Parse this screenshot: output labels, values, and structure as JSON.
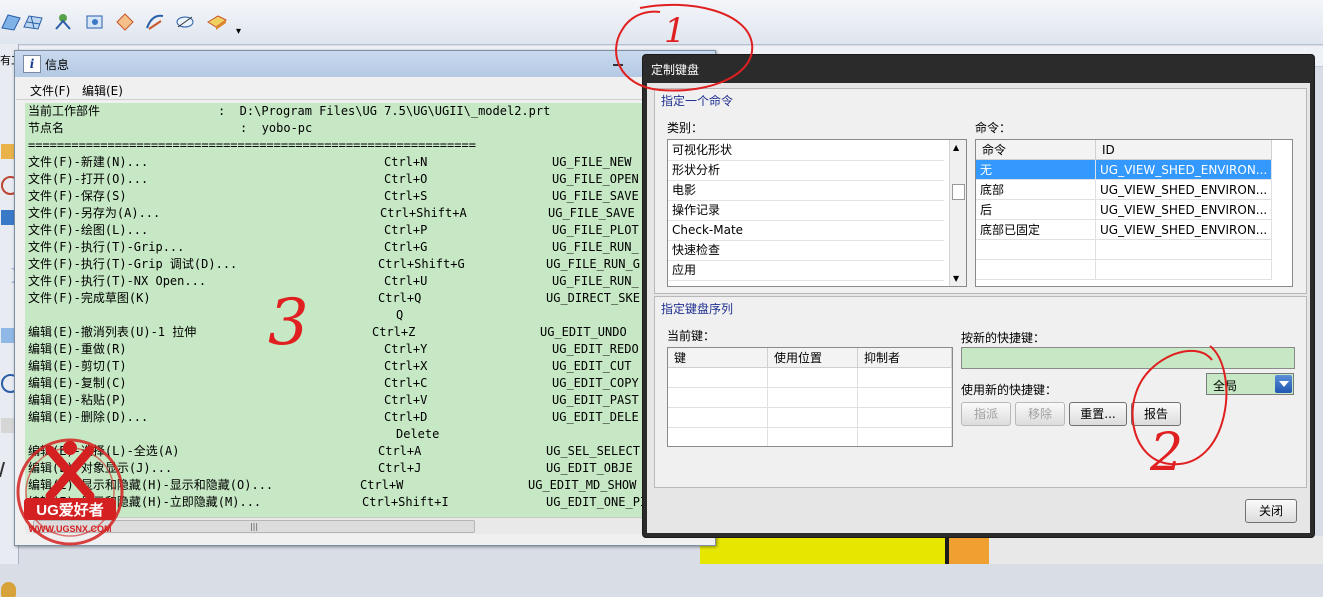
{
  "info_window": {
    "title": "信息",
    "menu": [
      "文件(F)",
      "编辑(E)"
    ],
    "header_lines": [
      {
        "label": "当前工作部件",
        "value": ":  D:\\Program Files\\UG 7.5\\UG\\UGII\\_model2.prt"
      },
      {
        "label": "节点名",
        "value": ":  yobo-pc"
      }
    ],
    "separator": "==============================================================",
    "rows": [
      {
        "cmd": "文件(F)-新建(N)...",
        "key": "Ctrl+N",
        "id": "UG_FILE_NEW"
      },
      {
        "cmd": "文件(F)-打开(O)...",
        "key": "Ctrl+O",
        "id": "UG_FILE_OPEN"
      },
      {
        "cmd": "文件(F)-保存(S)",
        "key": "Ctrl+S",
        "id": "UG_FILE_SAVE"
      },
      {
        "cmd": "文件(F)-另存为(A)...",
        "key": "Ctrl+Shift+A",
        "id": "UG_FILE_SAVE"
      },
      {
        "cmd": "文件(F)-绘图(L)...",
        "key": "Ctrl+P",
        "id": "UG_FILE_PLOT"
      },
      {
        "cmd": "文件(F)-执行(T)-Grip...",
        "key": "Ctrl+G",
        "id": "UG_FILE_RUN_"
      },
      {
        "cmd": "文件(F)-执行(T)-Grip 调试(D)...",
        "key": "Ctrl+Shift+G",
        "id": "UG_FILE_RUN_G"
      },
      {
        "cmd": "文件(F)-执行(T)-NX Open...",
        "key": "Ctrl+U",
        "id": "UG_FILE_RUN_"
      },
      {
        "cmd": "文件(F)-完成草图(K)",
        "key": "Ctrl+Q",
        "id": "UG_DIRECT_SKE"
      },
      {
        "cmd": "",
        "key": "Q",
        "id": ""
      },
      {
        "cmd": "编辑(E)-撤消列表(U)-1 拉伸",
        "key": "Ctrl+Z",
        "id": "UG_EDIT_UNDO"
      },
      {
        "cmd": "编辑(E)-重做(R)",
        "key": "Ctrl+Y",
        "id": "UG_EDIT_REDO"
      },
      {
        "cmd": "编辑(E)-剪切(T)",
        "key": "Ctrl+X",
        "id": "UG_EDIT_CUT"
      },
      {
        "cmd": "编辑(E)-复制(C)",
        "key": "Ctrl+C",
        "id": "UG_EDIT_COPY"
      },
      {
        "cmd": "编辑(E)-粘贴(P)",
        "key": "Ctrl+V",
        "id": "UG_EDIT_PAST"
      },
      {
        "cmd": "编辑(E)-删除(D)...",
        "key": "Ctrl+D",
        "id": "UG_EDIT_DELE"
      },
      {
        "cmd": "",
        "key": "Delete",
        "id": ""
      },
      {
        "cmd": "编辑(E)-选择(L)-全选(A)",
        "key": "Ctrl+A",
        "id": "UG_SEL_SELECT"
      },
      {
        "cmd": "编辑(E)-对象显示(J)...",
        "key": "Ctrl+J",
        "id": "UG_EDIT_OBJE"
      },
      {
        "cmd": "编辑(E)-显示和隐藏(H)-显示和隐藏(O)...",
        "key": "Ctrl+W",
        "id": "UG_EDIT_MD_SHOW"
      },
      {
        "cmd": "编辑(E)-显示和隐藏(H)-立即隐藏(M)...",
        "key": "Ctrl+Shift+I",
        "id": "UG_EDIT_ONE_PI"
      }
    ]
  },
  "keyboard_dialog": {
    "title": "定制键盘",
    "specify_command": {
      "group_title": "指定一个命令",
      "category_label": "类别：",
      "categories": [
        "可视化形状",
        "形状分析",
        "电影",
        "操作记录",
        "Check-Mate",
        "快速检查",
        "应用"
      ],
      "command_label": "命令：",
      "columns": [
        "命令",
        "ID"
      ],
      "commands": [
        {
          "name": "无",
          "id": "UG_VIEW_SHED_ENVIRON..."
        },
        {
          "name": "底部",
          "id": "UG_VIEW_SHED_ENVIRON..."
        },
        {
          "name": "后",
          "id": "UG_VIEW_SHED_ENVIRON..."
        },
        {
          "name": "底部已固定",
          "id": "UG_VIEW_SHED_ENVIRON..."
        }
      ]
    },
    "key_sequence": {
      "group_title": "指定键盘序列",
      "current_keys_label": "当前键：",
      "columns": [
        "键",
        "使用位置",
        "抑制者"
      ],
      "new_key_label": "按新的快捷键：",
      "use_new_key_label": "使用新的快捷键：",
      "scope_value": "全局",
      "assign_button": "指派",
      "remove_button": "移除",
      "reset_button": "重置...",
      "report_button": "报告"
    },
    "close_button": "关闭"
  },
  "annotations": {
    "num1": "1",
    "num2": "2",
    "num3": "3"
  },
  "watermark": {
    "brand": "UG爱好者",
    "url": "WWW.UGSNX.COM"
  },
  "left_tab": "有工"
}
